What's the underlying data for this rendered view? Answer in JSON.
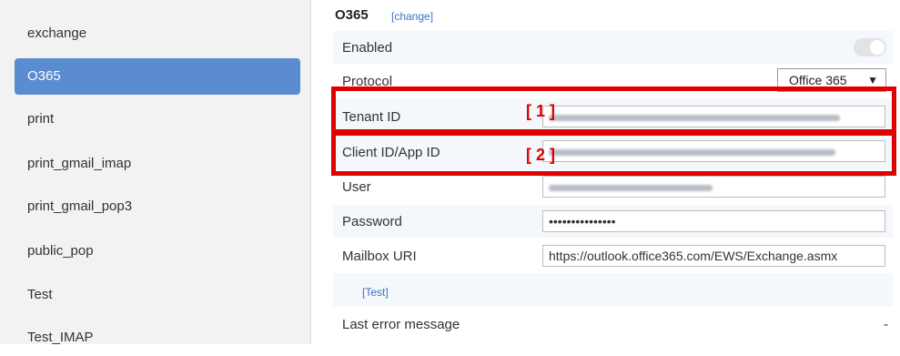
{
  "sidebar": {
    "items": [
      {
        "label": "exchange",
        "active": false
      },
      {
        "label": "O365",
        "active": true
      },
      {
        "label": "print",
        "active": false
      },
      {
        "label": "print_gmail_imap",
        "active": false
      },
      {
        "label": "print_gmail_pop3",
        "active": false
      },
      {
        "label": "public_pop",
        "active": false
      },
      {
        "label": "Test",
        "active": false
      },
      {
        "label": "Test_IMAP",
        "active": false
      }
    ]
  },
  "main": {
    "title": "O365",
    "change_link": "[change]",
    "enabled_label": "Enabled",
    "enabled_value": false,
    "protocol_label": "Protocol",
    "protocol_value": "Office 365",
    "tenant_label": "Tenant ID",
    "client_label": "Client ID/App ID",
    "user_label": "User",
    "password_label": "Password",
    "password_value": "•••••••••••••••",
    "mailbox_label": "Mailbox URI",
    "mailbox_value": "https://outlook.office365.com/EWS/Exchange.asmx",
    "test_link": "[Test]",
    "last_error_label": "Last error message",
    "last_error_value": "-"
  },
  "annotations": {
    "marker_1": "[ 1 ]",
    "marker_2": "[ 2 ]",
    "color": "#e00000"
  },
  "colors": {
    "accent": "#5b8ccf",
    "link": "#3b72c4"
  }
}
